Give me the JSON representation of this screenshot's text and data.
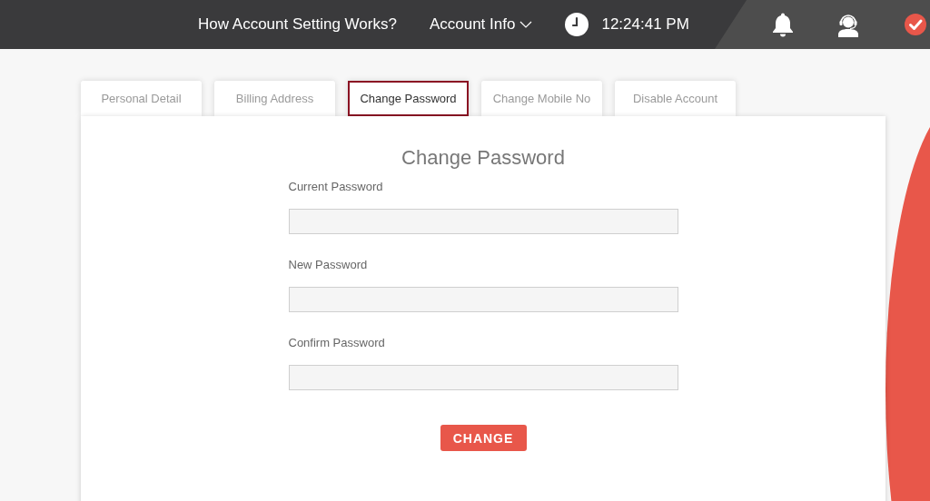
{
  "top_bar": {
    "links": [
      {
        "kind": "link",
        "label": "How Account Setting Works?"
      },
      {
        "kind": "dropdown",
        "label": "Account Info"
      }
    ],
    "time": "12:24:41 PM"
  },
  "tabs": [
    {
      "label": "Personal Detail",
      "selected": false
    },
    {
      "label": "Billing Address",
      "selected": false
    },
    {
      "label": "Change Password",
      "selected": true
    },
    {
      "label": "Change Mobile No",
      "selected": false
    },
    {
      "label": "Disable Account",
      "selected": false
    }
  ],
  "form": {
    "title": "Change Password",
    "fields": [
      {
        "label": "Current Password"
      },
      {
        "label": "New Password"
      },
      {
        "label": "Confirm Password"
      }
    ],
    "button": "CHANGE"
  }
}
